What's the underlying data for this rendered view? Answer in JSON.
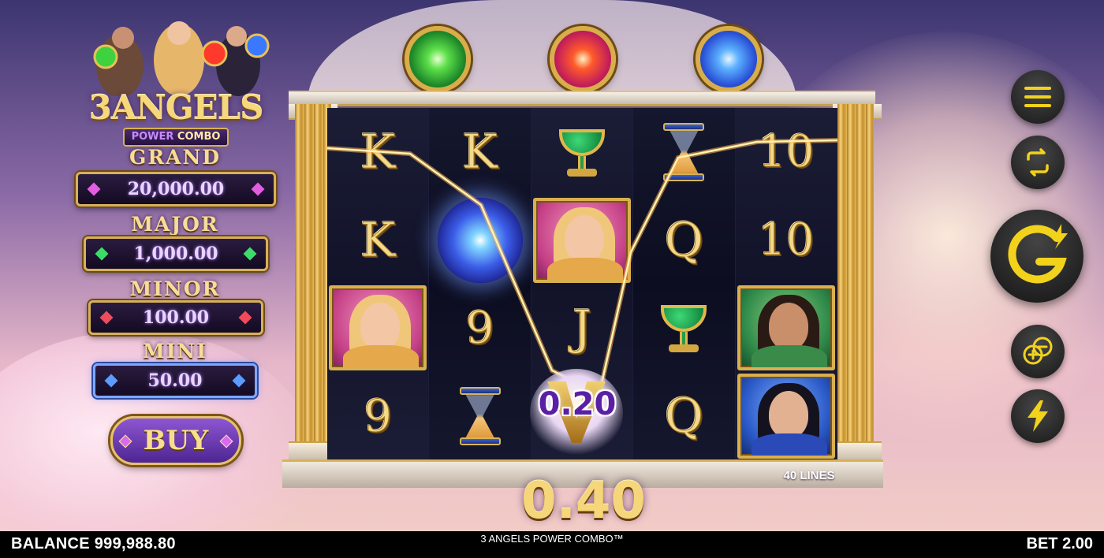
{
  "game": {
    "logo_title": "3ANGELS",
    "logo_subtitle_a": "POWER",
    "logo_subtitle_b": "COMBO"
  },
  "jackpots": [
    {
      "label": "GRAND",
      "value": "20,000.00"
    },
    {
      "label": "MAJOR",
      "value": "1,000.00"
    },
    {
      "label": "MINOR",
      "value": "100.00"
    },
    {
      "label": "MINI",
      "value": "50.00"
    }
  ],
  "buy_label": "BUY",
  "top_orbs": [
    "green-orb",
    "red-orb",
    "blue-orb"
  ],
  "reels": [
    [
      "K",
      "K",
      "angel-pink",
      "9"
    ],
    [
      "K",
      "blue-orb",
      "9",
      "hourglass"
    ],
    [
      "green-chalice",
      "angel-pink",
      "J",
      "win-badge"
    ],
    [
      "hourglass",
      "Q",
      "green-chalice",
      "Q"
    ],
    [
      "10",
      "10",
      "angel-green",
      "angel-blue"
    ]
  ],
  "win": {
    "line_win": "0.20",
    "total_win": "0.40"
  },
  "lines_label": "40 LINES",
  "controls": {
    "menu_icon": "hamburger-menu-icon",
    "autoplay_icon": "autoplay-cycle-icon",
    "spin_icon": "spin-g-icon",
    "bet_icon": "plus-minus-coins-icon",
    "turbo_icon": "lightning-bolt-icon"
  },
  "status_bar": {
    "balance": "BALANCE 999,988.80",
    "title": "3 ANGELS POWER COMBO™",
    "bet": "BET 2.00"
  },
  "colors": {
    "gold": "#d9b04f",
    "purple_text": "#5b1fa6",
    "control_icon": "#f2d21b",
    "bar": "#000000"
  }
}
